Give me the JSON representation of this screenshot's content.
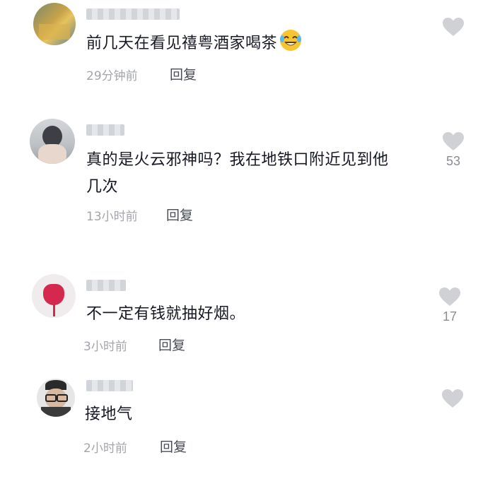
{
  "comments": [
    {
      "text": "前几天在看见禧粤酒家喝茶",
      "emoji": "rofl-emoji",
      "time": "29分钟前",
      "reply_label": "回复",
      "likes": ""
    },
    {
      "text_line1": "真的是火云邪神吗？我在地铁口附近见到他",
      "text_line2": "几次",
      "time": "13小时前",
      "reply_label": "回复",
      "likes": "53"
    },
    {
      "text": "不一定有钱就抽好烟。",
      "time": "3小时前",
      "reply_label": "回复",
      "likes": "17"
    },
    {
      "text": "接地气",
      "time": "2小时前",
      "reply_label": "回复",
      "likes": ""
    }
  ],
  "colors": {
    "text": "#161823",
    "meta": "#a3a5ab",
    "heart": "#d0d1d5"
  },
  "icons": {
    "like": "heart-icon"
  }
}
